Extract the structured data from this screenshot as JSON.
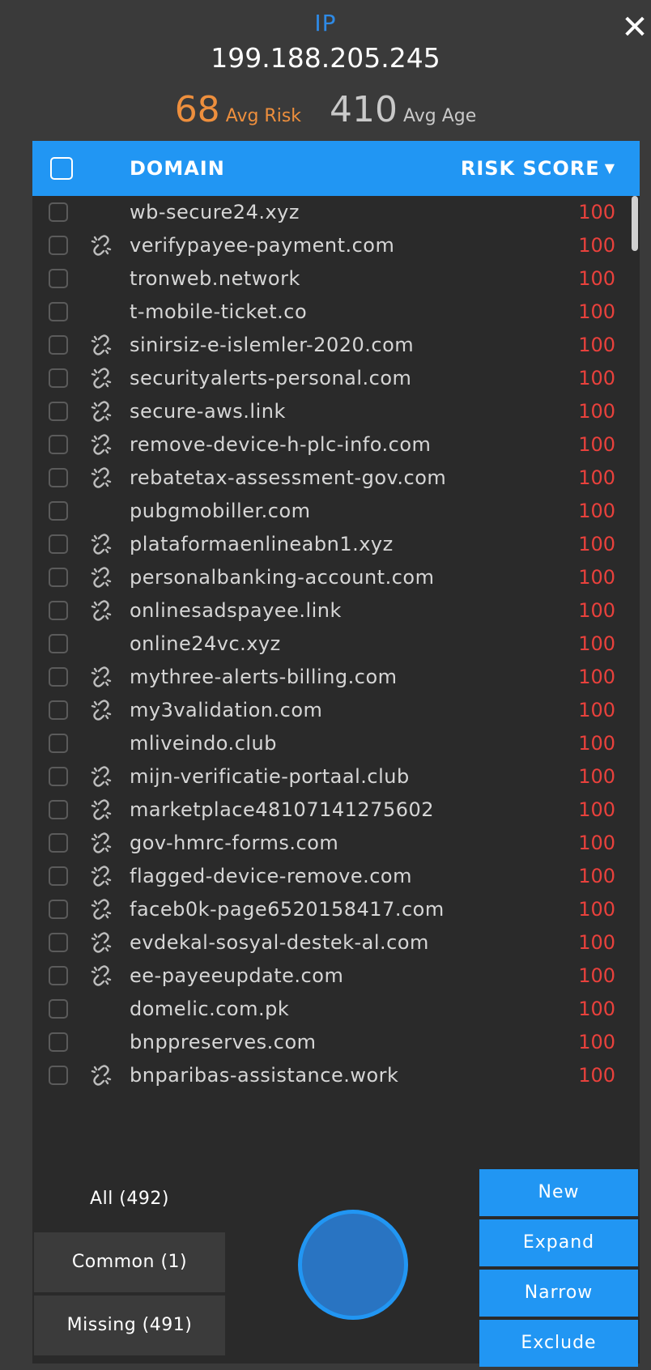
{
  "header": {
    "ip_label": "IP",
    "ip_value": "199.188.205.245",
    "avg_risk_value": "68",
    "avg_risk_label": "Avg Risk",
    "avg_age_value": "410",
    "avg_age_label": "Avg Age",
    "close_icon": "close-icon"
  },
  "table": {
    "col_domain": "DOMAIN",
    "col_risk": "RISK SCORE",
    "sort_icon": "caret-down-icon",
    "rows": [
      {
        "domain": "wb-secure24.xyz",
        "score": "100",
        "linked": false
      },
      {
        "domain": "verifypayee-payment.com",
        "score": "100",
        "linked": true
      },
      {
        "domain": "tronweb.network",
        "score": "100",
        "linked": false
      },
      {
        "domain": "t-mobile-ticket.co",
        "score": "100",
        "linked": false
      },
      {
        "domain": "sinirsiz-e-islemler-2020.com",
        "score": "100",
        "linked": true
      },
      {
        "domain": "securityalerts-personal.com",
        "score": "100",
        "linked": true
      },
      {
        "domain": "secure-aws.link",
        "score": "100",
        "linked": true
      },
      {
        "domain": "remove-device-h-plc-info.com",
        "score": "100",
        "linked": true
      },
      {
        "domain": "rebatetax-assessment-gov.com",
        "score": "100",
        "linked": true
      },
      {
        "domain": "pubgmobiller.com",
        "score": "100",
        "linked": false
      },
      {
        "domain": "plataformaenlineabn1.xyz",
        "score": "100",
        "linked": true
      },
      {
        "domain": "personalbanking-account.com",
        "score": "100",
        "linked": true
      },
      {
        "domain": "onlinesadspayee.link",
        "score": "100",
        "linked": true
      },
      {
        "domain": "online24vc.xyz",
        "score": "100",
        "linked": false
      },
      {
        "domain": "mythree-alerts-billing.com",
        "score": "100",
        "linked": true
      },
      {
        "domain": "my3validation.com",
        "score": "100",
        "linked": true
      },
      {
        "domain": "mliveindo.club",
        "score": "100",
        "linked": false
      },
      {
        "domain": "mijn-verificatie-portaal.club",
        "score": "100",
        "linked": true
      },
      {
        "domain": "marketplace48107141275602",
        "score": "100",
        "linked": true
      },
      {
        "domain": "gov-hmrc-forms.com",
        "score": "100",
        "linked": true
      },
      {
        "domain": "flagged-device-remove.com",
        "score": "100",
        "linked": true
      },
      {
        "domain": "faceb0k-page6520158417.com",
        "score": "100",
        "linked": true
      },
      {
        "domain": "evdekal-sosyal-destek-al.com",
        "score": "100",
        "linked": true
      },
      {
        "domain": "ee-payeeupdate.com",
        "score": "100",
        "linked": true
      },
      {
        "domain": "domelic.com.pk",
        "score": "100",
        "linked": false
      },
      {
        "domain": "bnppreserves.com",
        "score": "100",
        "linked": false
      },
      {
        "domain": "bnparibas-assistance.work",
        "score": "100",
        "linked": true
      }
    ]
  },
  "filters": {
    "all": "All (492)",
    "common": "Common (1)",
    "missing": "Missing (491)"
  },
  "actions": {
    "new": "New",
    "expand": "Expand",
    "narrow": "Narrow",
    "exclude": "Exclude"
  },
  "colors": {
    "accent": "#2196f3",
    "risk_text": "#e8413c",
    "avg_risk": "#ee8f3d"
  }
}
